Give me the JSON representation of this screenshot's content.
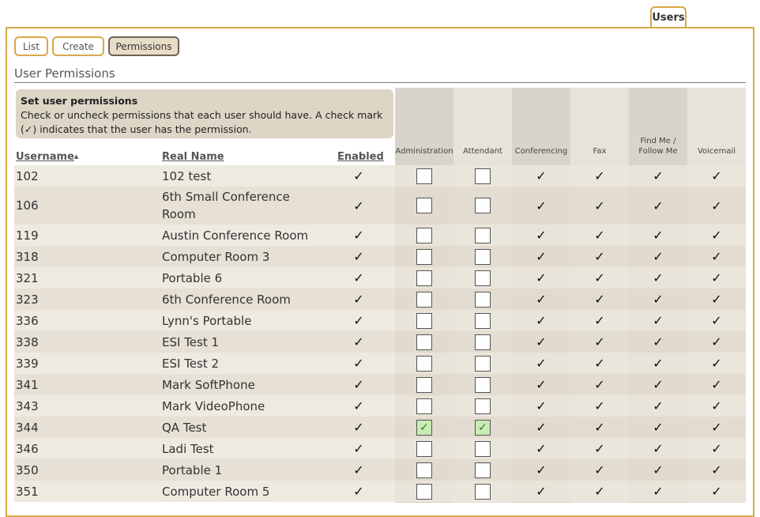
{
  "top_tab": "Users",
  "subtabs": [
    "List",
    "Create",
    "Permissions"
  ],
  "section_title": "User Permissions",
  "info": {
    "heading": "Set user permissions",
    "text": "Check or uncheck permissions that each user should have. A check mark (✓) indicates that the user has the permission."
  },
  "columns": {
    "username": "Username",
    "sort_glyph": "▲",
    "real_name": "Real Name",
    "enabled": "Enabled",
    "perm": [
      "Administration",
      "Attendant",
      "Conferencing",
      "Fax",
      "Find Me / Follow Me",
      "Voicemail"
    ]
  },
  "check_glyph": "✓",
  "colors": {
    "accent": "#d8a84a",
    "checked_bg": "#c8ecb4"
  },
  "rows": [
    {
      "username": "102",
      "real_name": "102 test",
      "admin": false,
      "attendant": false
    },
    {
      "username": "106",
      "real_name": "6th Small Conference Room",
      "admin": false,
      "attendant": false
    },
    {
      "username": "119",
      "real_name": "Austin Conference Room",
      "admin": false,
      "attendant": false
    },
    {
      "username": "318",
      "real_name": "Computer Room 3",
      "admin": false,
      "attendant": false
    },
    {
      "username": "321",
      "real_name": "Portable 6",
      "admin": false,
      "attendant": false
    },
    {
      "username": "323",
      "real_name": "6th Conference Room",
      "admin": false,
      "attendant": false
    },
    {
      "username": "336",
      "real_name": "Lynn's Portable",
      "admin": false,
      "attendant": false
    },
    {
      "username": "338",
      "real_name": "ESI Test 1",
      "admin": false,
      "attendant": false
    },
    {
      "username": "339",
      "real_name": "ESI Test 2",
      "admin": false,
      "attendant": false
    },
    {
      "username": "341",
      "real_name": "Mark SoftPhone",
      "admin": false,
      "attendant": false
    },
    {
      "username": "343",
      "real_name": "Mark VideoPhone",
      "admin": false,
      "attendant": false
    },
    {
      "username": "344",
      "real_name": "QA Test",
      "admin": true,
      "attendant": true
    },
    {
      "username": "346",
      "real_name": "Ladi Test",
      "admin": false,
      "attendant": false
    },
    {
      "username": "350",
      "real_name": "Portable 1",
      "admin": false,
      "attendant": false
    },
    {
      "username": "351",
      "real_name": "Computer Room 5",
      "admin": false,
      "attendant": false
    }
  ]
}
